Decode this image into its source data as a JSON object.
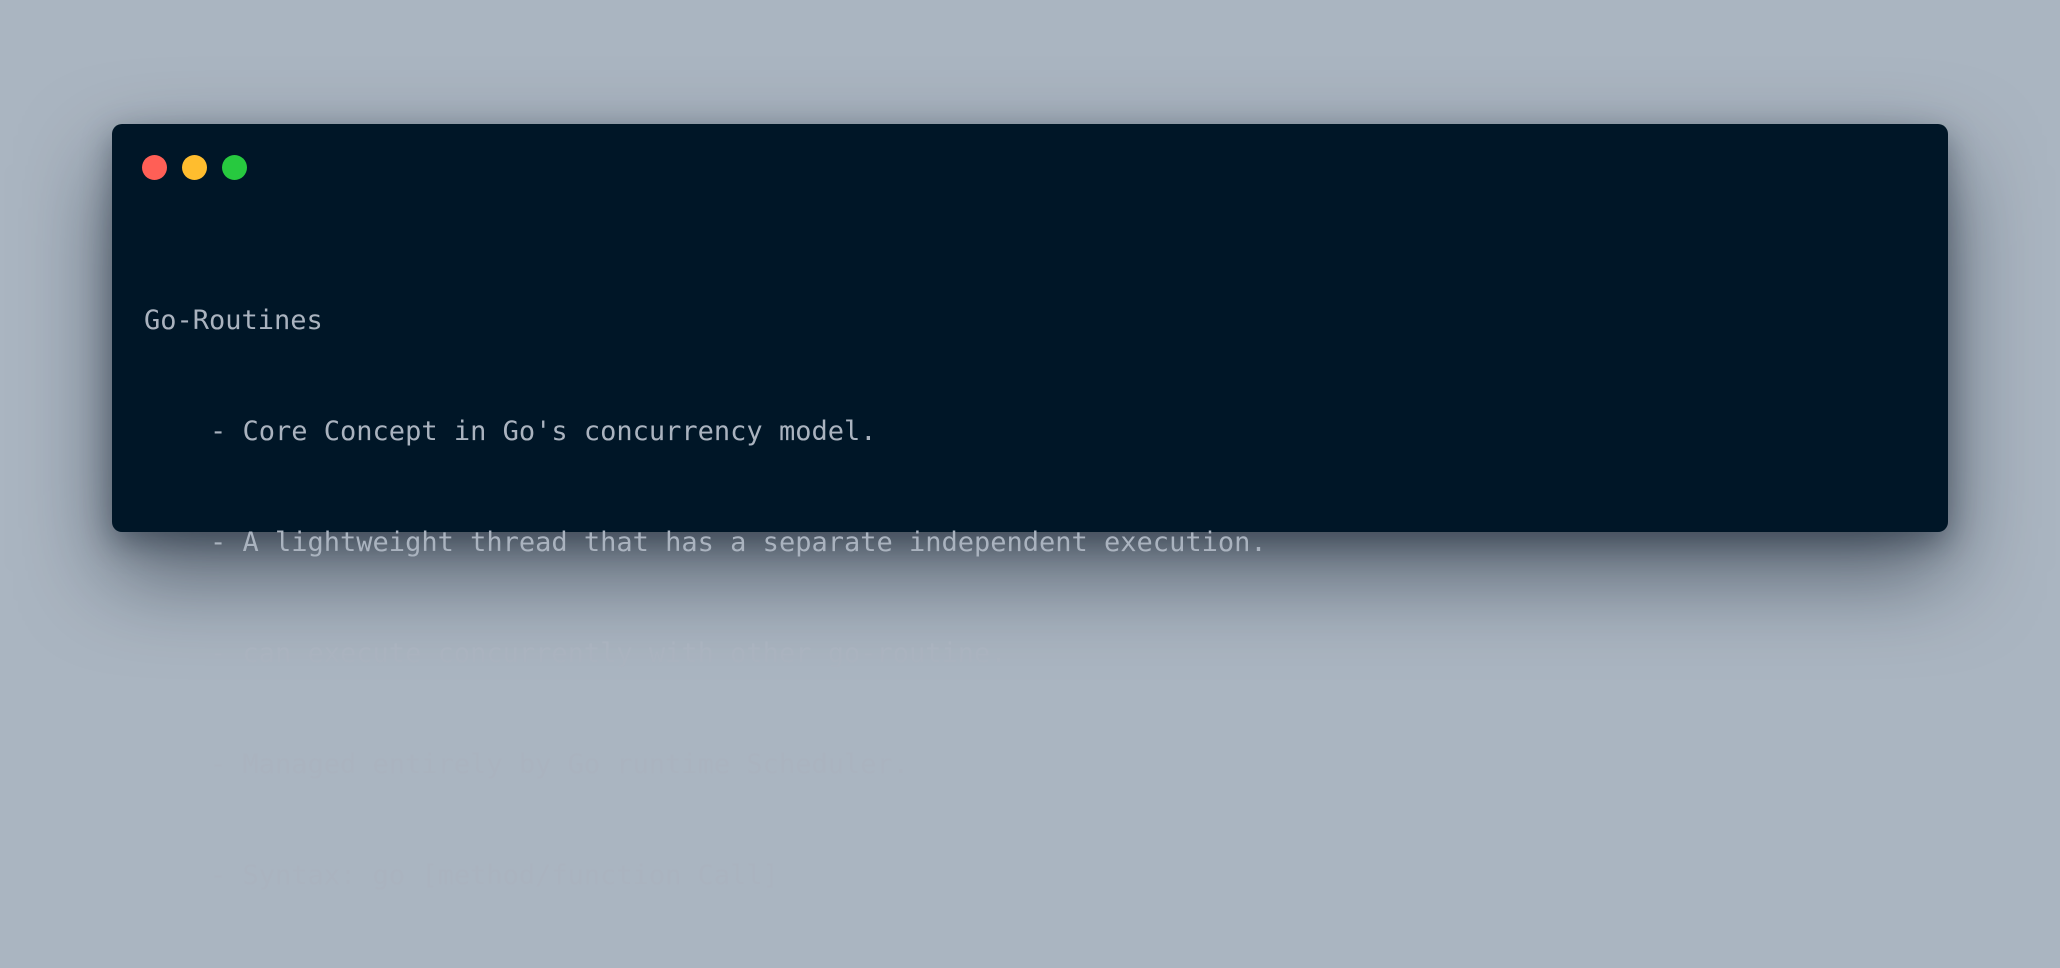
{
  "window": {
    "buttons": [
      {
        "name": "close",
        "color": "#ff5f56"
      },
      {
        "name": "minimize",
        "color": "#ffbd2e"
      },
      {
        "name": "zoom",
        "color": "#27c93f"
      }
    ]
  },
  "code": {
    "heading": "Go-Routines",
    "bullets": [
      "- Core Concept in Go's concurrency model.",
      "- A lightweight thread that has a separate independent execution.",
      "- can execute concurrently with other go-routine.",
      "- Managed entirely by Go runtime Scheduler.",
      "- Syntax: go [method/function Call]"
    ]
  }
}
